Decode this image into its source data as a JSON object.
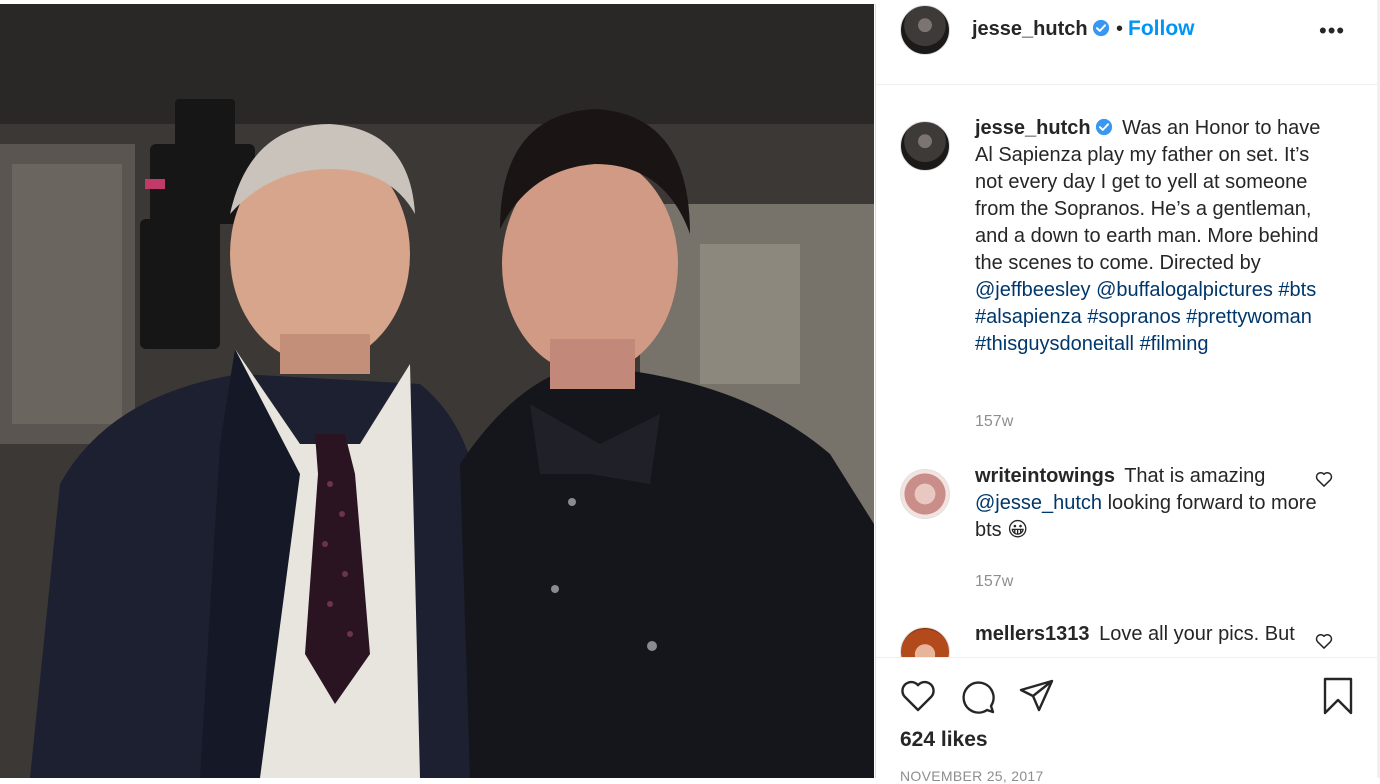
{
  "post": {
    "author": "jesse_hutch",
    "follow_label": "Follow",
    "dot": "•",
    "more_label": "•••",
    "caption_text": "Was an Honor to have Al Sapienza play my father on set. It’s not every day I get to yell at someone from the Sopranos. He’s a gentleman, and a down to earth man. More behind the scenes to come. Directed by ",
    "caption_mentions": [
      "@jeffbeesley",
      "@buffalogalpictures"
    ],
    "caption_hashtags": [
      "#bts",
      "#alsapienza",
      "#sopranos",
      "#prettywoman",
      "#thisguysdoneitall",
      "#filming"
    ],
    "caption_time": "157w",
    "likes": "624 likes",
    "date": "NOVEMBER 25, 2017"
  },
  "comments": [
    {
      "user": "writeintowings",
      "text_before": "That is amazing",
      "mention": "@jesse_hutch",
      "text_after": "looking forward to more bts",
      "emoji": "😀",
      "time": "157w"
    },
    {
      "user": "mellers1313",
      "text_before": "Love all your pics. But",
      "mention": "",
      "text_after": "",
      "emoji": "",
      "time": ""
    }
  ],
  "icons": {
    "verified": "verified-badge-icon",
    "like": "heart-icon",
    "comment": "comment-bubble-icon",
    "share": "paper-plane-icon",
    "save": "bookmark-icon",
    "more": "ellipsis-icon"
  },
  "colors": {
    "link_blue": "#0095f6",
    "mention_navy": "#00376b",
    "meta_gray": "#8e8e8e",
    "verified_blue": "#3897f0"
  }
}
